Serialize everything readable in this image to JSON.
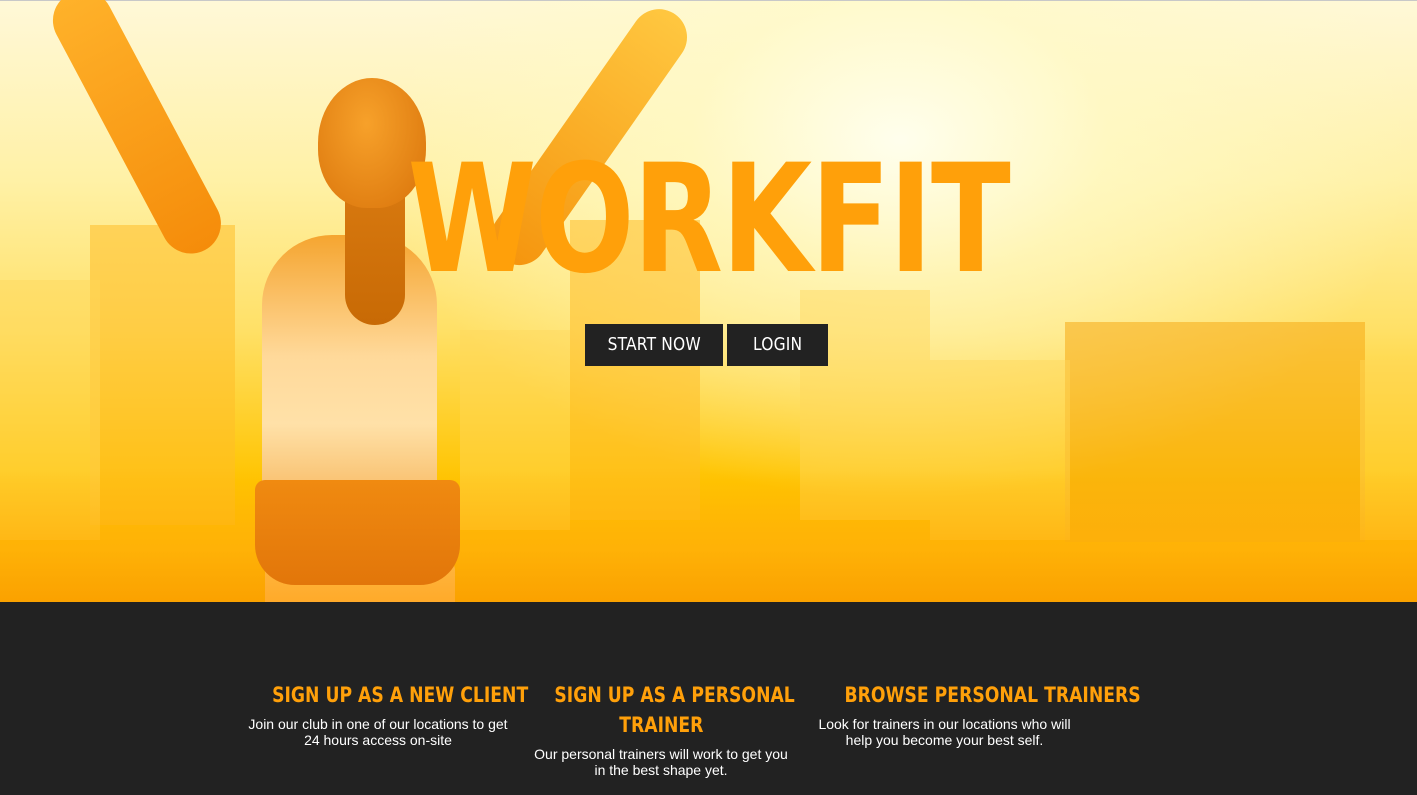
{
  "hero": {
    "title": "WORKFIT",
    "buttons": {
      "start": "START NOW",
      "login": "LOGIN"
    }
  },
  "features": [
    {
      "heading_line1": "SIGN UP AS A NEW CLIENT",
      "heading_line2": "",
      "description_line1": "Join our club in one of our locations to get",
      "description_line2": "24 hours access on-site"
    },
    {
      "heading_line1": "SIGN UP AS A PERSONAL",
      "heading_line2": "TRAINER",
      "description_line1": "Our personal trainers will work to get you",
      "description_line2": "in the best shape yet."
    },
    {
      "heading_line1": "BROWSE PERSONAL TRAINERS",
      "heading_line2": "",
      "description_line1": "Look for trainers in our locations who will",
      "description_line2": "help you become your best self."
    }
  ],
  "colors": {
    "accent": "#ffa00a",
    "dark": "#222222",
    "button_text": "#ffffff"
  }
}
